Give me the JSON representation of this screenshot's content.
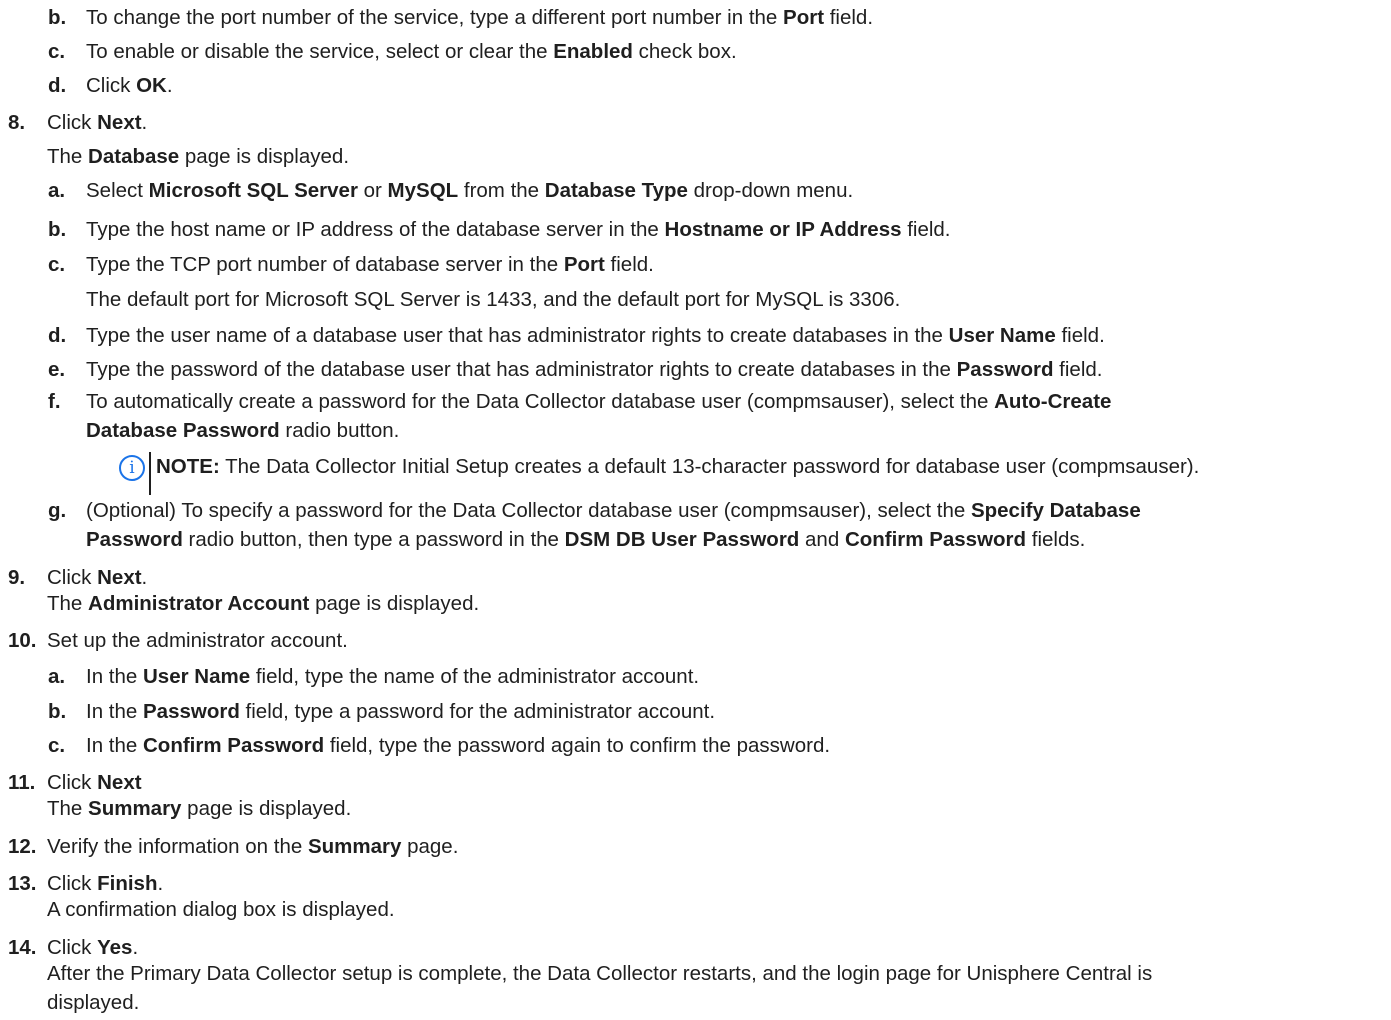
{
  "items": [
    {
      "n": "b.",
      "segs": [
        [
          "To change the port number of the service, type a different port number in the ",
          0
        ],
        [
          "Port",
          1
        ],
        [
          " field.",
          0
        ]
      ]
    },
    {
      "n": "c.",
      "segs": [
        [
          "To enable or disable the service, select or clear the ",
          0
        ],
        [
          "Enabled",
          1
        ],
        [
          " check box.",
          0
        ]
      ]
    },
    {
      "n": "d.",
      "segs": [
        [
          "Click ",
          0
        ],
        [
          "OK",
          1
        ],
        [
          ".",
          0
        ]
      ]
    },
    {
      "n": "8.",
      "segs": [
        [
          "Click ",
          0
        ],
        [
          "Next",
          1
        ],
        [
          ".",
          0
        ]
      ]
    },
    {
      "n": "",
      "segs": [
        [
          "The ",
          0
        ],
        [
          "Database",
          1
        ],
        [
          " page is displayed.",
          0
        ]
      ]
    },
    {
      "n": "a.",
      "segs": [
        [
          "Select ",
          0
        ],
        [
          "Microsoft SQL Server",
          1
        ],
        [
          " or ",
          0
        ],
        [
          "MySQL",
          1
        ],
        [
          " from the ",
          0
        ],
        [
          "Database Type",
          1
        ],
        [
          " drop-down menu.",
          0
        ]
      ]
    },
    {
      "n": "b.",
      "segs": [
        [
          "Type the host name or IP address of the database server in the ",
          0
        ],
        [
          "Hostname or IP Address",
          1
        ],
        [
          " field.",
          0
        ]
      ]
    },
    {
      "n": "c.",
      "segs": [
        [
          "Type the TCP port number of database server in the ",
          0
        ],
        [
          "Port",
          1
        ],
        [
          " field.",
          0
        ]
      ]
    },
    {
      "n": "",
      "segs": [
        [
          "The default port for Microsoft SQL Server is 1433, and the default port for MySQL is 3306.",
          0
        ]
      ]
    },
    {
      "n": "d.",
      "segs": [
        [
          "Type the user name of a database user that has administrator rights to create databases in the ",
          0
        ],
        [
          "User Name",
          1
        ],
        [
          " field.",
          0
        ]
      ]
    },
    {
      "n": "e.",
      "segs": [
        [
          "Type the password of the database user that has administrator rights to create databases in the ",
          0
        ],
        [
          "Password",
          1
        ],
        [
          " field.",
          0
        ]
      ]
    },
    {
      "n": "f.",
      "segs": [
        [
          "To automatically create a password for the Data Collector database user (compmsauser), select the ",
          0
        ],
        [
          "Auto-Create",
          1
        ]
      ]
    },
    {
      "n": "",
      "segs": [
        [
          "Database Password",
          1
        ],
        [
          " radio button.",
          0
        ]
      ]
    },
    {
      "n": "",
      "segs": [
        [
          "NOTE:",
          1
        ],
        [
          " The Data Collector Initial Setup creates a default 13-character password for database user (compmsauser).",
          0
        ]
      ]
    },
    {
      "n": "g.",
      "segs": [
        [
          "(Optional) To specify a password for the Data Collector database user (compmsauser), select the ",
          0
        ],
        [
          "Specify Database",
          1
        ]
      ]
    },
    {
      "n": "",
      "segs": [
        [
          "Password",
          1
        ],
        [
          " radio button, then type a password in the ",
          0
        ],
        [
          "DSM DB User Password",
          1
        ],
        [
          " and ",
          0
        ],
        [
          "Confirm Password",
          1
        ],
        [
          " fields.",
          0
        ]
      ]
    },
    {
      "n": "9.",
      "segs": [
        [
          "Click ",
          0
        ],
        [
          "Next",
          1
        ],
        [
          ".",
          0
        ]
      ]
    },
    {
      "n": "",
      "segs": [
        [
          "The ",
          0
        ],
        [
          "Administrator Account",
          1
        ],
        [
          " page is displayed.",
          0
        ]
      ]
    },
    {
      "n": "10.",
      "segs": [
        [
          "Set up the administrator account.",
          0
        ]
      ]
    },
    {
      "n": "a.",
      "segs": [
        [
          "In the ",
          0
        ],
        [
          "User Name",
          1
        ],
        [
          " field, type the name of the administrator account.",
          0
        ]
      ]
    },
    {
      "n": "b.",
      "segs": [
        [
          "In the ",
          0
        ],
        [
          "Password",
          1
        ],
        [
          " field, type a password for the administrator account.",
          0
        ]
      ]
    },
    {
      "n": "c.",
      "segs": [
        [
          "In the ",
          0
        ],
        [
          "Confirm Password",
          1
        ],
        [
          " field, type the password again to confirm the password.",
          0
        ]
      ]
    },
    {
      "n": "11.",
      "segs": [
        [
          "Click ",
          0
        ],
        [
          "Next",
          1
        ]
      ]
    },
    {
      "n": "",
      "segs": [
        [
          "The ",
          0
        ],
        [
          "Summary",
          1
        ],
        [
          " page is displayed.",
          0
        ]
      ]
    },
    {
      "n": "12.",
      "segs": [
        [
          "Verify the information on the ",
          0
        ],
        [
          "Summary",
          1
        ],
        [
          " page.",
          0
        ]
      ]
    },
    {
      "n": "13.",
      "segs": [
        [
          "Click ",
          0
        ],
        [
          "Finish",
          1
        ],
        [
          ".",
          0
        ]
      ]
    },
    {
      "n": "",
      "segs": [
        [
          "A confirmation dialog box is displayed.",
          0
        ]
      ]
    },
    {
      "n": "14.",
      "segs": [
        [
          "Click ",
          0
        ],
        [
          "Yes",
          1
        ],
        [
          ".",
          0
        ]
      ]
    },
    {
      "n": "",
      "segs": [
        [
          "After the Primary Data Collector setup is complete, the Data Collector restarts, and the login page for Unisphere Central is",
          0
        ]
      ]
    },
    {
      "n": "",
      "segs": [
        [
          "displayed.",
          0
        ]
      ]
    }
  ]
}
